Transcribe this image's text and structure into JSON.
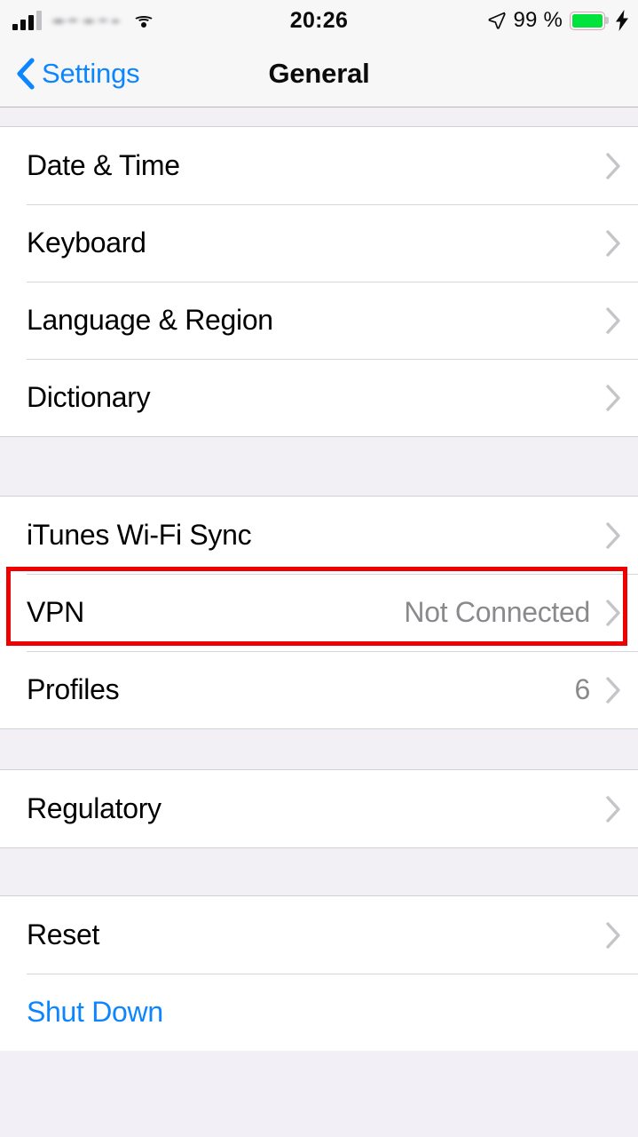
{
  "status_bar": {
    "carrier": "",
    "carrier_blurred": true,
    "signal_bars_filled": 3,
    "signal_bars_total": 4,
    "wifi_icon": "wifi-icon",
    "time": "20:26",
    "location_icon": "location-arrow-icon",
    "battery_percent": "99 %",
    "battery_level": 99,
    "battery_color": "#00E23C",
    "charging": true,
    "charging_icon": "lightning-bolt-icon"
  },
  "nav": {
    "back_label": "Settings",
    "back_icon": "chevron-left-icon",
    "title": "General"
  },
  "colors": {
    "accent_blue": "#0C86FF",
    "value_gray": "#8A8A8E",
    "chevron_gray": "#C4C4C9",
    "annotation_red": "#EE0000",
    "group_background": "#FFFFFF",
    "page_background": "#F3EFF6"
  },
  "groups": [
    {
      "rows": [
        {
          "label": "Date & Time",
          "value": "",
          "chevron": true,
          "style": "default"
        },
        {
          "label": "Keyboard",
          "value": "",
          "chevron": true,
          "style": "default"
        },
        {
          "label": "Language & Region",
          "value": "",
          "chevron": true,
          "style": "default"
        },
        {
          "label": "Dictionary",
          "value": "",
          "chevron": true,
          "style": "default"
        }
      ]
    },
    {
      "rows": [
        {
          "label": "iTunes Wi-Fi Sync",
          "value": "",
          "chevron": true,
          "style": "default"
        },
        {
          "label": "VPN",
          "value": "Not Connected",
          "chevron": true,
          "style": "default",
          "highlighted": true
        },
        {
          "label": "Profiles",
          "value": "6",
          "chevron": true,
          "style": "default"
        }
      ]
    },
    {
      "rows": [
        {
          "label": "Regulatory",
          "value": "",
          "chevron": true,
          "style": "default"
        }
      ]
    },
    {
      "rows": [
        {
          "label": "Reset",
          "value": "",
          "chevron": true,
          "style": "default"
        },
        {
          "label": "Shut Down",
          "value": "",
          "chevron": false,
          "style": "link"
        }
      ]
    }
  ],
  "annotation": {
    "target_row": "VPN",
    "shape": "rectangle",
    "color": "#EE0000"
  }
}
